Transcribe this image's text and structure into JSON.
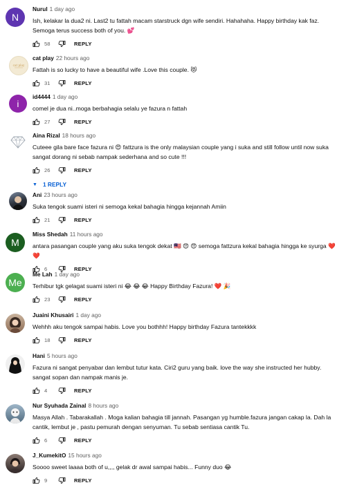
{
  "colors": {
    "accent": "#065fd4",
    "heart": "#e74c3c"
  },
  "comments": [
    {
      "author": "Nurul",
      "time": "1 day ago",
      "text": "Ish, kelakar la dua2 ni. Last2 tu fattah macam starstruck dgn wife sendiri. Hahahaha. Happy birthday kak faz. Semoga terus success both of you. 💕",
      "likes": "58",
      "reply_label": "REPLY",
      "avatar": {
        "letter": "N",
        "color": "#5e35b1"
      }
    },
    {
      "author": "cat play",
      "time": "22 hours ago",
      "text": "Fattah is so lucky to have a beautiful wife .Love this couple. 😻",
      "likes": "31",
      "reply_label": "REPLY",
      "avatar": {
        "letter": "",
        "color": "#f3ead4",
        "icon": "cat-logo-avatar"
      }
    },
    {
      "author": "id4444",
      "time": "1 day ago",
      "text": "comel je dua ni..moga berbahagia selalu ye fazura n fattah",
      "likes": "27",
      "reply_label": "REPLY",
      "avatar": {
        "letter": "i",
        "color": "#8e24aa"
      }
    },
    {
      "author": "Aina Rizal",
      "time": "18 hours ago",
      "text": "Cuteee gila bare face fazura ni 😍 fattzura is the only malaysian couple yang i suka and still follow until now suka sangat dorang ni sebab nampak sederhana and so cute !!!",
      "likes": "26",
      "reply_label": "REPLY",
      "replies_label": "1 REPLY",
      "avatar": {
        "letter": "",
        "color": "#ffffff",
        "icon": "diamond-avatar"
      }
    },
    {
      "author": "Ani",
      "time": "23 hours ago",
      "text": "Suka tengok suami isteri ni semoga kekal bahagia hingga kejannah Amiin",
      "likes": "21",
      "reply_label": "REPLY",
      "avatar": {
        "letter": "",
        "color": "#3a3f4b",
        "icon": "photo-avatar"
      }
    },
    {
      "author": "Miss Shedah",
      "time": "11 hours ago",
      "text": "antara pasangan couple yang aku suka tengok dekat 🇲🇾 😍 😍 semoga fattzura kekal bahagia hingga ke syurga ❤️ ❤️",
      "likes": "6",
      "reply_label": "REPLY",
      "avatar": {
        "letter": "M",
        "color": "#1b5e20"
      }
    },
    {
      "author": "Me Lah",
      "time": "1 day ago",
      "text": "Terhibur tgk gelagat suami isteri ni 😂 😂 😂 Happy Birthday Fazura! ❤️ 🎉",
      "likes": "23",
      "reply_label": "REPLY",
      "avatar": {
        "letter": "Me",
        "color": "#4caf50"
      }
    },
    {
      "author": "Juaini Khusairi",
      "time": "1 day ago",
      "text": "Wehhh aku tengok sampai habis. Love you bothhh! Happy birthday Fazura tantekkkk",
      "likes": "18",
      "reply_label": "REPLY",
      "avatar": {
        "letter": "",
        "color": "#b08970",
        "icon": "photo-avatar"
      }
    },
    {
      "author": "Hani",
      "time": "5 hours ago",
      "text": "Fazura ni sangat penyabar dan lembut tutur kata. Ciri2 guru yang baik. love the way she instructed her hubby. sangat sopan dan nampak manis je.",
      "likes": "4",
      "reply_label": "REPLY",
      "avatar": {
        "letter": "",
        "color": "#f0f0f0",
        "icon": "hijab-avatar"
      }
    },
    {
      "author": "Nur Syuhada Zainal",
      "time": "8 hours ago",
      "text": "Masya Allah . Tabarakallah . Moga kalian bahagia till jannah. Pasangan yg humble.fazura jangan cakap la. Dah la cantik, lembut je , pastu pemurah dengan senyuman. Tu sebab sentiasa cantik Tu.",
      "likes": "6",
      "reply_label": "REPLY",
      "avatar": {
        "letter": "",
        "color": "#6d8fa8",
        "icon": "photo-avatar"
      }
    },
    {
      "author": "J_KumekitO",
      "time": "15 hours ago",
      "text": "Soooo sweet laaaa both of u,,,, gelak dr awal sampai habis... Funny duo 😂",
      "likes": "9",
      "reply_label": "REPLY",
      "avatar": {
        "letter": "",
        "color": "#4a4040",
        "icon": "photo-avatar"
      }
    }
  ]
}
